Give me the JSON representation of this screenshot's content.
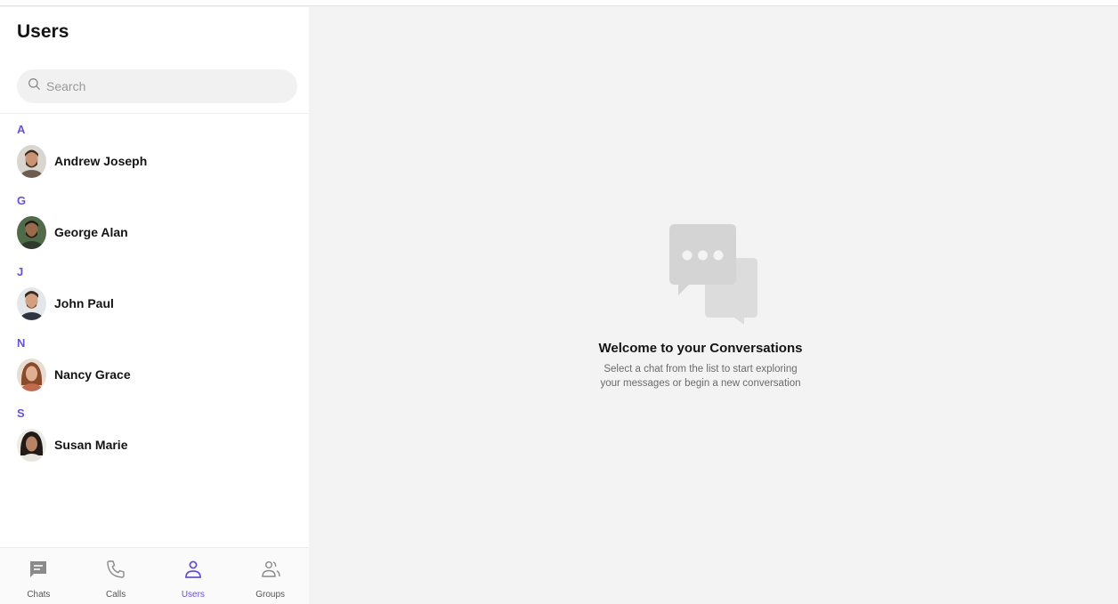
{
  "sidebar": {
    "title": "Users",
    "search": {
      "placeholder": "Search",
      "value": ""
    },
    "groups": [
      {
        "letter": "A",
        "users": [
          {
            "name": "Andrew Joseph"
          }
        ]
      },
      {
        "letter": "G",
        "users": [
          {
            "name": "George Alan"
          }
        ]
      },
      {
        "letter": "J",
        "users": [
          {
            "name": "John Paul"
          }
        ]
      },
      {
        "letter": "N",
        "users": [
          {
            "name": "Nancy Grace"
          }
        ]
      },
      {
        "letter": "S",
        "users": [
          {
            "name": "Susan Marie"
          }
        ]
      }
    ]
  },
  "bottom_nav": {
    "items": [
      {
        "label": "Chats",
        "icon": "chat-icon",
        "active": false
      },
      {
        "label": "Calls",
        "icon": "phone-icon",
        "active": false
      },
      {
        "label": "Users",
        "icon": "user-icon",
        "active": true
      },
      {
        "label": "Groups",
        "icon": "group-icon",
        "active": false
      }
    ]
  },
  "main": {
    "empty_icon": "chat-bubbles-icon",
    "title": "Welcome to your Conversations",
    "line1": "Select a chat from the list to start exploring",
    "line2": "your messages or begin a new conversation"
  },
  "colors": {
    "accent": "#6852d6",
    "sidebar_bg": "#ffffff",
    "main_bg": "#f3f3f3",
    "icon_gray": "#d8d8d8"
  }
}
